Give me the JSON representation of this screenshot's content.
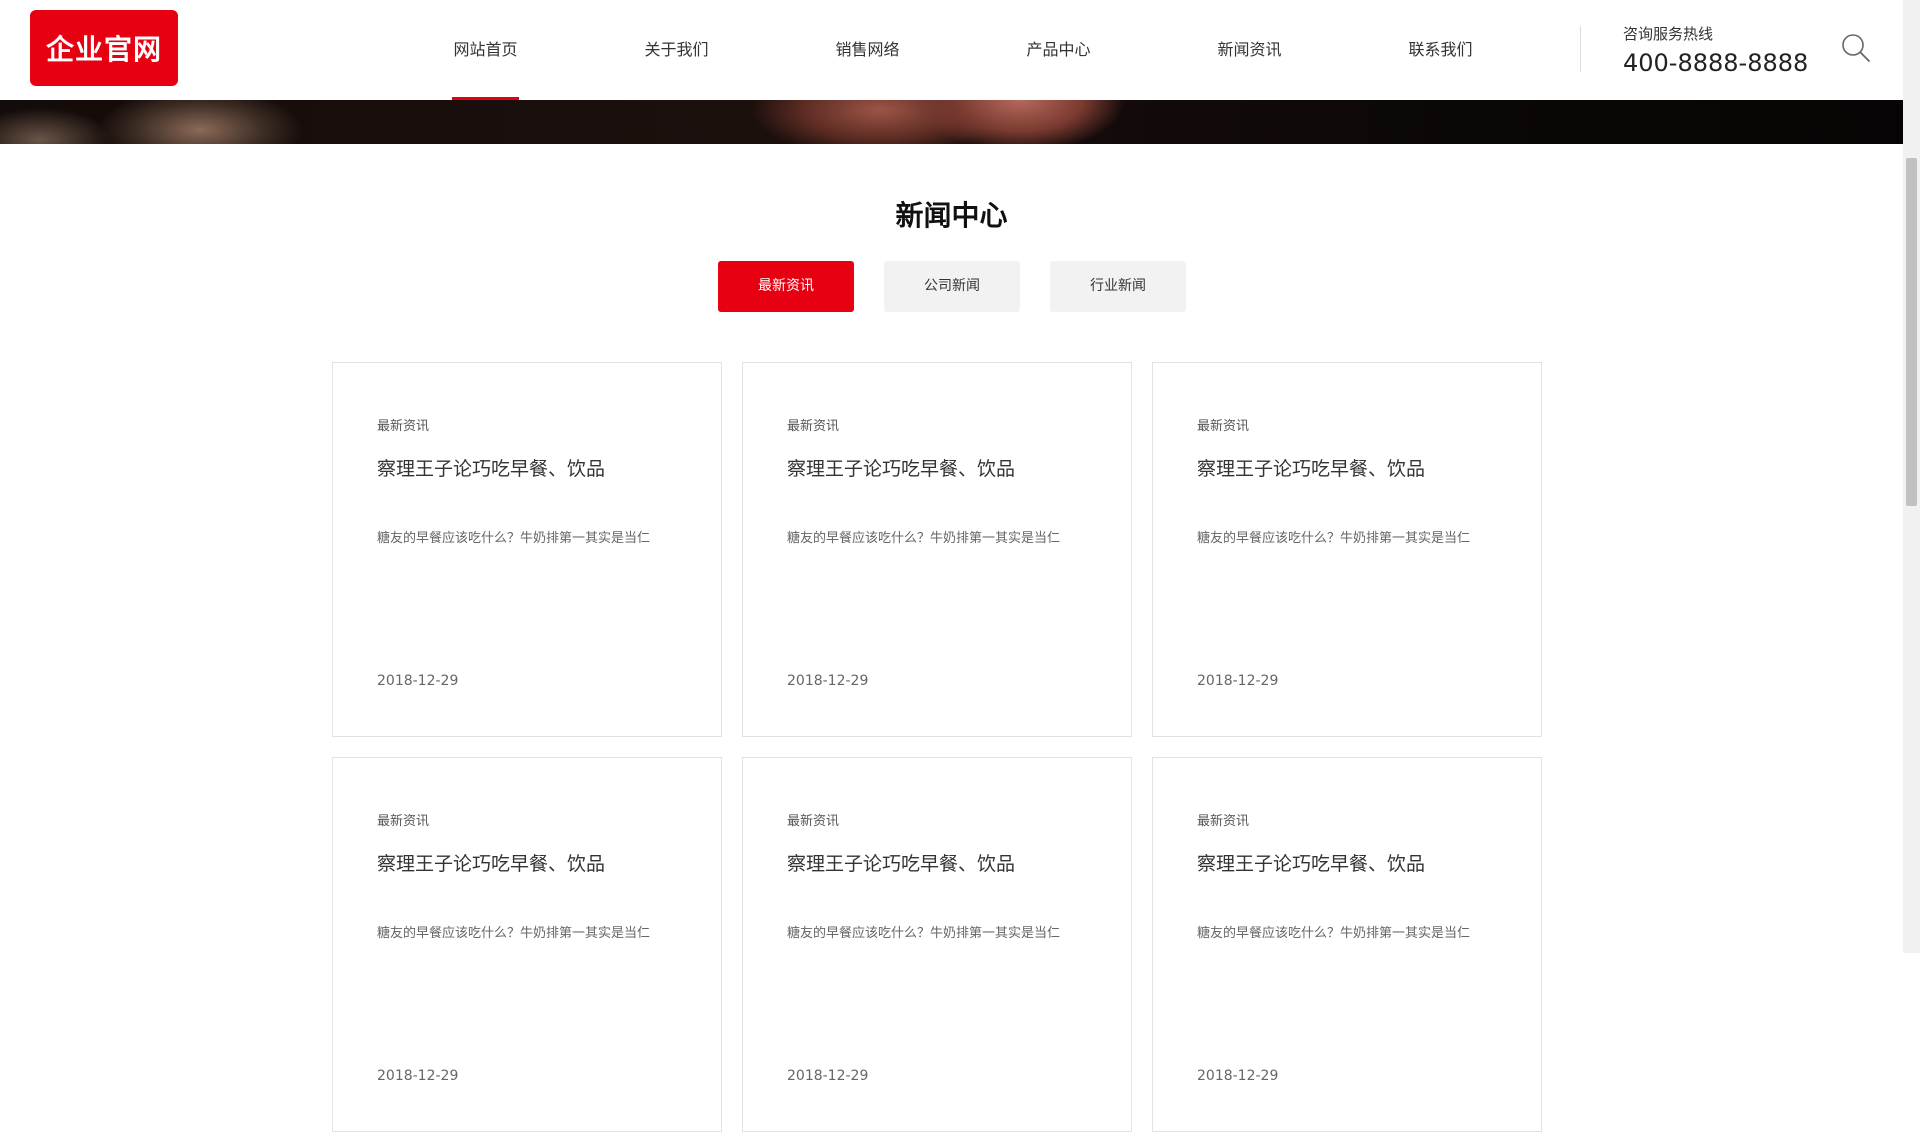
{
  "header": {
    "logo_text": "企业官网",
    "nav": [
      {
        "label": "网站首页",
        "active": true
      },
      {
        "label": "关于我们"
      },
      {
        "label": "销售网络"
      },
      {
        "label": "产品中心"
      },
      {
        "label": "新闻资讯"
      },
      {
        "label": "联系我们"
      }
    ],
    "hotline_label": "咨询服务热线",
    "hotline_number": "400-8888-8888",
    "search_icon": "search-icon"
  },
  "section": {
    "title": "新闻中心",
    "tabs": [
      {
        "label": "最新资讯",
        "active": true
      },
      {
        "label": "公司新闻"
      },
      {
        "label": "行业新闻"
      }
    ]
  },
  "news": [
    {
      "category": "最新资讯",
      "title": "察理王子论巧吃早餐、饮品",
      "desc": "糖友的早餐应该吃什么？牛奶排第一其实是当仁",
      "date": "2018-12-29"
    },
    {
      "category": "最新资讯",
      "title": "察理王子论巧吃早餐、饮品",
      "desc": "糖友的早餐应该吃什么？牛奶排第一其实是当仁",
      "date": "2018-12-29"
    },
    {
      "category": "最新资讯",
      "title": "察理王子论巧吃早餐、饮品",
      "desc": "糖友的早餐应该吃什么？牛奶排第一其实是当仁",
      "date": "2018-12-29"
    },
    {
      "category": "最新资讯",
      "title": "察理王子论巧吃早餐、饮品",
      "desc": "糖友的早餐应该吃什么？牛奶排第一其实是当仁",
      "date": "2018-12-29"
    },
    {
      "category": "最新资讯",
      "title": "察理王子论巧吃早餐、饮品",
      "desc": "糖友的早餐应该吃什么？牛奶排第一其实是当仁",
      "date": "2018-12-29"
    },
    {
      "category": "最新资讯",
      "title": "察理王子论巧吃早餐、饮品",
      "desc": "糖友的早餐应该吃什么？牛奶排第一其实是当仁",
      "date": "2018-12-29"
    }
  ],
  "colors": {
    "accent": "#e60012",
    "tab_inactive": "#f2f2f2"
  }
}
